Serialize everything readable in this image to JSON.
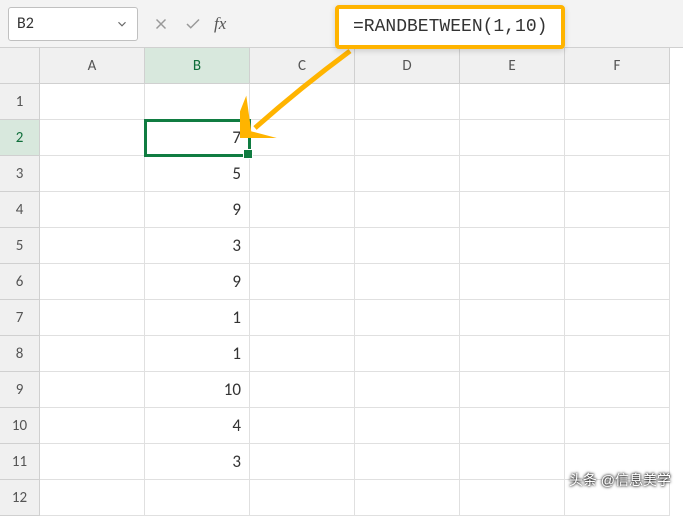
{
  "name_box": "B2",
  "formula": "=RANDBETWEEN(1,10)",
  "columns": [
    "A",
    "B",
    "C",
    "D",
    "E",
    "F"
  ],
  "rows": [
    "1",
    "2",
    "3",
    "4",
    "5",
    "6",
    "7",
    "8",
    "9",
    "10",
    "11",
    "12"
  ],
  "active_col": "B",
  "active_row": "2",
  "cells": {
    "B2": "7",
    "B3": "5",
    "B4": "9",
    "B5": "3",
    "B6": "9",
    "B7": "1",
    "B8": "1",
    "B9": "10",
    "B10": "4",
    "B11": "3"
  },
  "watermark": "头条 @信息美学"
}
